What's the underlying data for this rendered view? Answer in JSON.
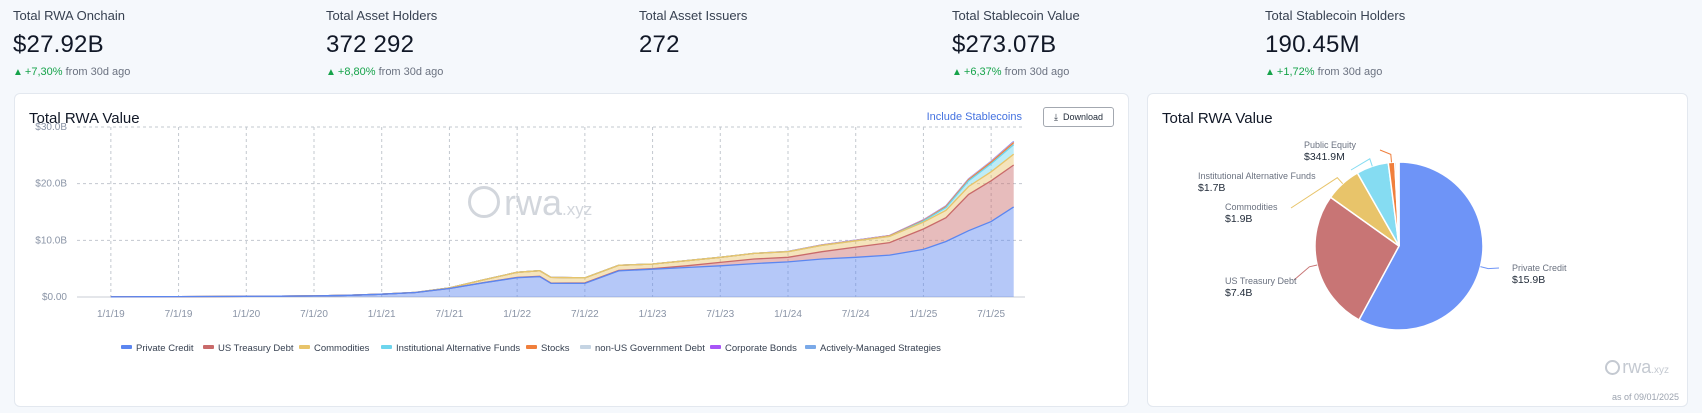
{
  "stats": [
    {
      "label": "Total RWA Onchain",
      "value": "$27.92B",
      "change": "+7,30%",
      "suffix": "from 30d ago"
    },
    {
      "label": "Total Asset Holders",
      "value": "372 292",
      "change": "+8,80%",
      "suffix": "from 30d ago"
    },
    {
      "label": "Total Asset Issuers",
      "value": "272",
      "change": "",
      "suffix": ""
    },
    {
      "label": "Total Stablecoin Value",
      "value": "$273.07B",
      "change": "+6,37%",
      "suffix": "from 30d ago"
    },
    {
      "label": "Total Stablecoin Holders",
      "value": "190.45M",
      "change": "+1,72%",
      "suffix": "from 30d ago"
    }
  ],
  "area_panel": {
    "title": "Total RWA Value",
    "include_stablecoins": "Include Stablecoins",
    "download": "Download",
    "watermark": "rwa",
    "watermark_suffix": ".xyz"
  },
  "pie_panel": {
    "title": "Total RWA Value",
    "watermark": "rwa",
    "watermark_suffix": ".xyz",
    "as_of": "as of 09/01/2025"
  },
  "chart_data": [
    {
      "type": "area",
      "stacked": true,
      "title": "Total RWA Value",
      "x": [
        "2019-01",
        "2019-04",
        "2019-07",
        "2019-10",
        "2020-01",
        "2020-04",
        "2020-07",
        "2020-10",
        "2021-01",
        "2021-04",
        "2021-07",
        "2021-10",
        "2022-01",
        "2022-03",
        "2022-04",
        "2022-07",
        "2022-10",
        "2023-01",
        "2023-04",
        "2023-07",
        "2023-10",
        "2024-01",
        "2024-04",
        "2024-07",
        "2024-10",
        "2025-01",
        "2025-03",
        "2025-05",
        "2025-07",
        "2025-09"
      ],
      "x_ticks": [
        "1/1/19",
        "7/1/19",
        "1/1/20",
        "7/1/20",
        "1/1/21",
        "7/1/21",
        "1/1/22",
        "7/1/22",
        "1/1/23",
        "7/1/23",
        "1/1/24",
        "7/1/24",
        "1/1/25",
        "7/1/25"
      ],
      "y_ticks": [
        "$0.00",
        "$10.0B",
        "$20.0B",
        "$30.0B"
      ],
      "ylim": [
        0,
        30
      ],
      "y_unit": "B USD",
      "grid": true,
      "legend_position": "bottom",
      "series": [
        {
          "name": "Private Credit",
          "color": "#5b86f0",
          "values": [
            0.03,
            0.05,
            0.07,
            0.09,
            0.12,
            0.15,
            0.2,
            0.3,
            0.5,
            0.8,
            1.5,
            2.5,
            3.4,
            3.6,
            2.4,
            2.4,
            4.6,
            4.9,
            5.2,
            5.5,
            5.9,
            6.2,
            6.7,
            7.0,
            7.4,
            8.4,
            9.8,
            11.7,
            13.3,
            15.9
          ]
        },
        {
          "name": "US Treasury Debt",
          "color": "#c96a6a",
          "values": [
            0,
            0,
            0,
            0,
            0,
            0,
            0,
            0,
            0,
            0,
            0,
            0.02,
            0.05,
            0.05,
            0.06,
            0.08,
            0.1,
            0.12,
            0.3,
            0.6,
            0.8,
            0.8,
            1.3,
            1.8,
            2.2,
            3.6,
            4.2,
            6.4,
            7.2,
            7.4
          ]
        },
        {
          "name": "Commodities",
          "color": "#e8c46a",
          "values": [
            0,
            0,
            0,
            0,
            0,
            0,
            0,
            0,
            0,
            0.02,
            0.1,
            0.5,
            0.9,
            1.0,
            1.0,
            0.9,
            0.9,
            0.8,
            0.9,
            0.9,
            1.0,
            1.0,
            1.1,
            1.1,
            1.1,
            1.2,
            1.3,
            1.4,
            1.6,
            1.9
          ]
        },
        {
          "name": "Institutional Alternative Funds",
          "color": "#6dd5ed",
          "values": [
            0,
            0,
            0,
            0,
            0,
            0,
            0,
            0,
            0,
            0,
            0,
            0,
            0,
            0,
            0,
            0,
            0,
            0,
            0,
            0,
            0,
            0,
            0,
            0,
            0,
            0.2,
            0.5,
            1.0,
            1.4,
            1.7
          ]
        },
        {
          "name": "Stocks",
          "color": "#f07f3c",
          "values": [
            0,
            0,
            0,
            0,
            0,
            0,
            0,
            0,
            0,
            0,
            0,
            0,
            0,
            0,
            0,
            0,
            0,
            0,
            0,
            0,
            0,
            0.02,
            0.04,
            0.06,
            0.08,
            0.1,
            0.15,
            0.2,
            0.28,
            0.34
          ]
        },
        {
          "name": "non-US Government Debt",
          "color": "#c5d4e3",
          "values": [
            0,
            0,
            0,
            0,
            0,
            0,
            0,
            0,
            0,
            0,
            0,
            0,
            0,
            0,
            0,
            0,
            0,
            0,
            0,
            0,
            0,
            0.02,
            0.03,
            0.04,
            0.05,
            0.06,
            0.07,
            0.08,
            0.09,
            0.1
          ]
        },
        {
          "name": "Corporate Bonds",
          "color": "#a855f7",
          "values": [
            0,
            0,
            0,
            0,
            0,
            0,
            0,
            0,
            0,
            0,
            0,
            0,
            0,
            0,
            0,
            0,
            0,
            0,
            0,
            0,
            0,
            0.01,
            0.02,
            0.03,
            0.03,
            0.04,
            0.05,
            0.05,
            0.06,
            0.07
          ]
        },
        {
          "name": "Actively-Managed Strategies",
          "color": "#7aa9e8",
          "values": [
            0,
            0,
            0,
            0,
            0,
            0,
            0,
            0,
            0,
            0,
            0,
            0,
            0,
            0,
            0,
            0,
            0,
            0,
            0,
            0,
            0,
            0,
            0,
            0,
            0,
            0.01,
            0.02,
            0.03,
            0.04,
            0.05
          ]
        }
      ]
    },
    {
      "type": "pie",
      "title": "Total RWA Value",
      "slices": [
        {
          "name": "Private Credit",
          "label": "$15.9B",
          "value": 15.9,
          "color": "#6e94f7",
          "labeled": true
        },
        {
          "name": "US Treasury Debt",
          "label": "$7.4B",
          "value": 7.4,
          "color": "#c87575",
          "labeled": true
        },
        {
          "name": "Commodities",
          "label": "$1.9B",
          "value": 1.9,
          "color": "#e8c46a",
          "labeled": true
        },
        {
          "name": "Institutional Alternative Funds",
          "label": "$1.7B",
          "value": 1.7,
          "color": "#85dcf2",
          "labeled": true
        },
        {
          "name": "Public Equity",
          "label": "$341.9M",
          "value": 0.342,
          "color": "#f07f3c",
          "labeled": true
        },
        {
          "name": "non-US Government Debt",
          "label": "",
          "value": 0.1,
          "color": "#c5d4e3",
          "labeled": false
        },
        {
          "name": "Corporate Bonds",
          "label": "",
          "value": 0.07,
          "color": "#a855f7",
          "labeled": false
        },
        {
          "name": "Actively-Managed Strategies",
          "label": "",
          "value": 0.05,
          "color": "#7aa9e8",
          "labeled": false
        }
      ]
    }
  ]
}
